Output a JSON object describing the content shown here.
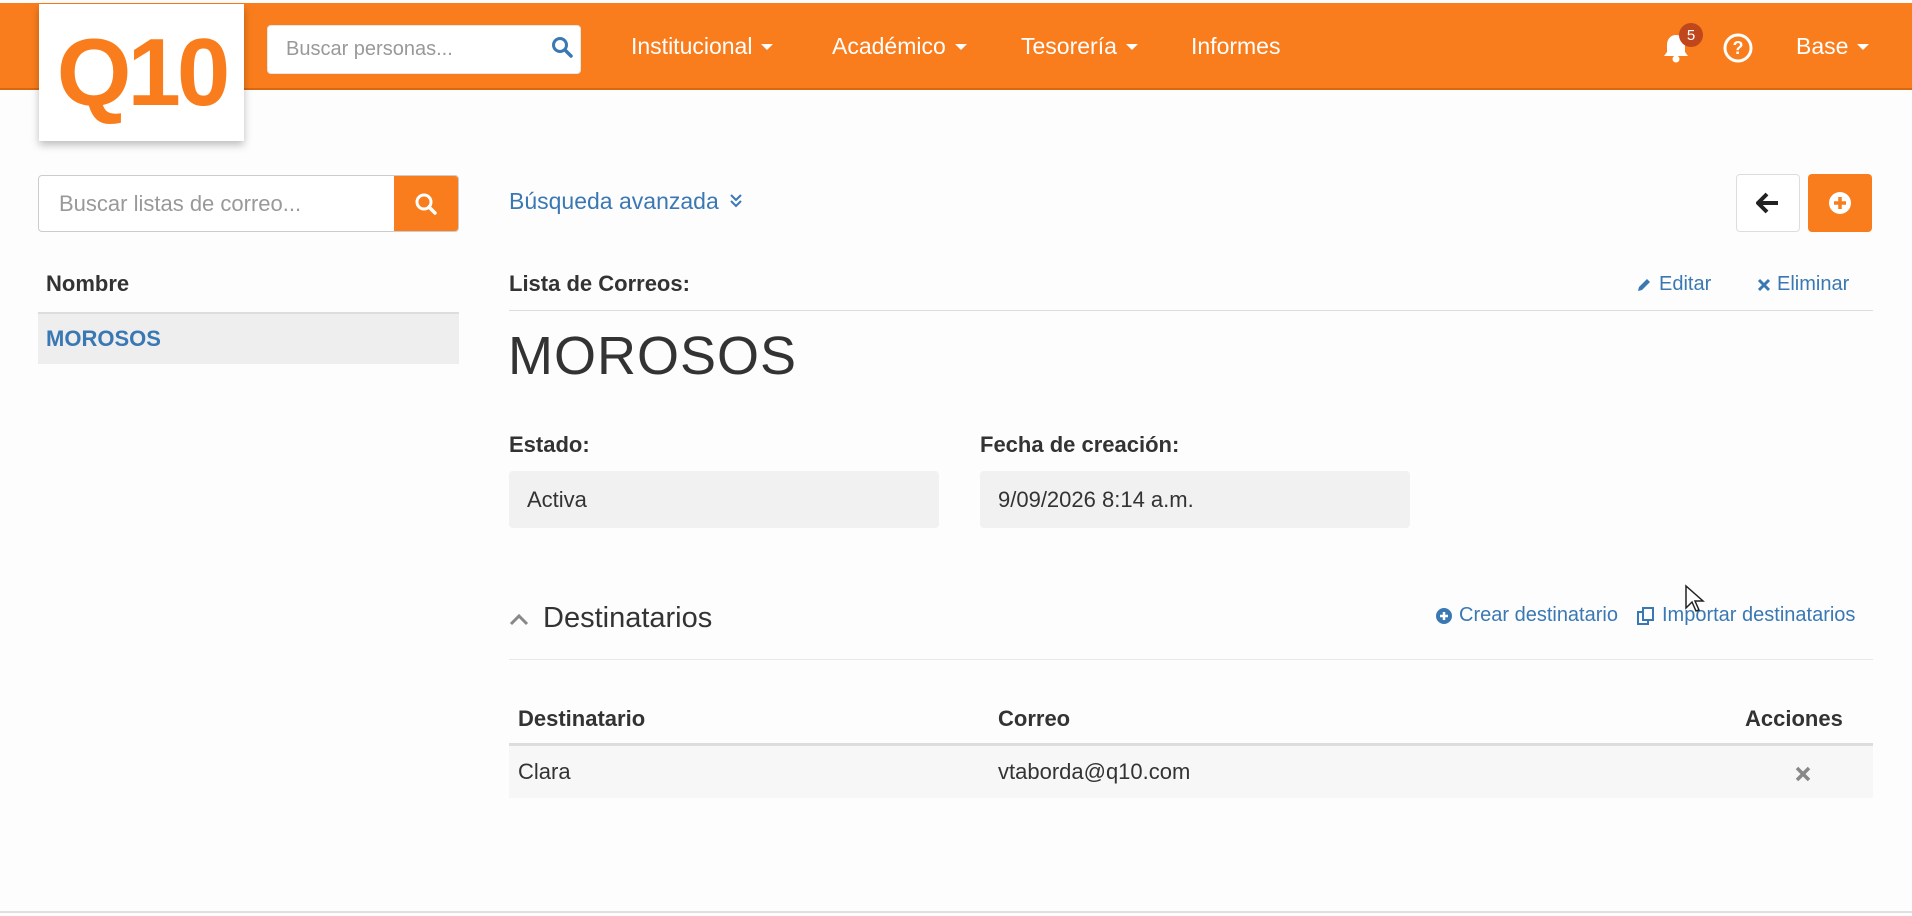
{
  "header": {
    "logo": "Q10",
    "people_search_placeholder": "Buscar personas...",
    "menu": [
      {
        "label": "Institucional"
      },
      {
        "label": "Académico"
      },
      {
        "label": "Tesorería"
      },
      {
        "label": "Informes"
      }
    ],
    "notification_count": "5",
    "user_menu": "Base"
  },
  "sidebar": {
    "search_placeholder": "Buscar listas de correo...",
    "column_header": "Nombre",
    "items": [
      {
        "label": "MOROSOS"
      }
    ]
  },
  "main": {
    "advanced_search": "Búsqueda avanzada",
    "section_label": "Lista de Correos:",
    "edit_label": "Editar",
    "delete_label": "Eliminar",
    "list_name": "MOROSOS",
    "fields": {
      "estado_label": "Estado:",
      "estado_value": "Activa",
      "fecha_label": "Fecha de creación:",
      "fecha_value": "9/09/2026 8:14 a.m."
    },
    "recipients": {
      "title": "Destinatarios",
      "create_label": "Crear destinatario",
      "import_label": "Importar destinatarios",
      "columns": [
        "Destinatario",
        "Correo",
        "Acciones"
      ],
      "rows": [
        {
          "name": "Clara",
          "email": "vtaborda@q10.com"
        }
      ]
    }
  },
  "colors": {
    "brand": "#f97d1c",
    "link": "#3a78b4"
  }
}
